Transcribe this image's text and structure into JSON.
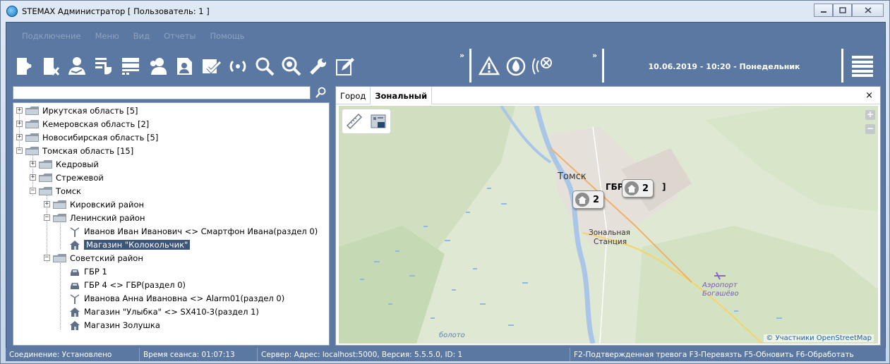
{
  "window": {
    "title": "STEMAX Администратор [ Пользователь: 1 ]",
    "controls": [
      "minimize-icon",
      "maximize-icon",
      "close-icon"
    ]
  },
  "menu": {
    "items": [
      "Подключение",
      "Меню",
      "Вид",
      "Отчеты",
      "Помощь"
    ]
  },
  "toolbar": {
    "icons": [
      "exit-door-icon",
      "exit-door-x-icon",
      "user-handshake-icon",
      "pointer-list-icon",
      "list-table-icon",
      "users-icon",
      "report-icon",
      "confirm-check-icon",
      "refresh-icon",
      "search-icon",
      "zoom-target-icon",
      "wrench-icon",
      "edit-icon"
    ],
    "overflow_label": "»",
    "alarm_icons": [
      "warning-triangle-icon",
      "fire-drop-icon",
      "no-signal-icon"
    ],
    "alarm_overflow_label": "»",
    "datetime": "10.06.2019 - 10:20 - Понедельник",
    "menu_icon": "hamburger-icon"
  },
  "search": {
    "value": "",
    "placeholder": ""
  },
  "tree": {
    "nodes": [
      {
        "label": "Иркутская область [5]",
        "expander": "+",
        "icon": "folder-icon"
      },
      {
        "label": "Кемеровская область [2]",
        "expander": "+",
        "icon": "folder-icon"
      },
      {
        "label": "Новосибирская область [5]",
        "expander": "+",
        "icon": "folder-icon"
      },
      {
        "label": "Томская область [15]",
        "expander": "−",
        "icon": "folder-icon"
      },
      {
        "label": "Кедровый",
        "expander": "+",
        "icon": "folder-icon"
      },
      {
        "label": "Стрежевой",
        "expander": "+",
        "icon": "folder-icon"
      },
      {
        "label": "Томск",
        "expander": "−",
        "icon": "folder-icon"
      },
      {
        "label": "Кировский район",
        "expander": "+",
        "icon": "folder-icon"
      },
      {
        "label": "Ленинский район",
        "expander": "−",
        "icon": "folder-icon"
      },
      {
        "label": "Иванов Иван Иванович <> Смартфон Ивана(раздел 0)",
        "expander": "",
        "icon": "person-antenna-icon"
      },
      {
        "label": "Магазин \"Колокольчик\"",
        "expander": "",
        "icon": "house-icon",
        "selected": true
      },
      {
        "label": "Советский район",
        "expander": "−",
        "icon": "folder-icon"
      },
      {
        "label": "ГБР 1",
        "expander": "",
        "icon": "car-icon"
      },
      {
        "label": "ГБР 4 <> ГБР(раздел 0)",
        "expander": "",
        "icon": "car-icon"
      },
      {
        "label": "Иванова Анна Ивановна <> Alarm01(раздел 0)",
        "expander": "",
        "icon": "person-antenna-icon"
      },
      {
        "label": "Магазин \"Улыбка\" <> SX410-3(раздел 1)",
        "expander": "",
        "icon": "house-icon"
      },
      {
        "label": "Магазин Золушка",
        "expander": "",
        "icon": "house-icon"
      }
    ]
  },
  "map": {
    "tabs": [
      {
        "label": "Город",
        "active": false
      },
      {
        "label": "Зональный",
        "active": true
      }
    ],
    "close_label": "×",
    "zoom_in_label": "+",
    "zoom_out_label": "−",
    "labels": {
      "city": "Томск",
      "gbr": "ГБР",
      "gbr_tail": "]",
      "station_1": "Зональная",
      "station_2": "Станция",
      "airport_1": "Аэропорт",
      "airport_2": "Богашёво",
      "swamp": "болото"
    },
    "clusters": [
      {
        "count": "2"
      },
      {
        "count": "2"
      }
    ],
    "attribution": "© Участники OpenStreetMap"
  },
  "status": {
    "connection": "Соединение: Установлено",
    "session": "Время сеанса: 01:07:13",
    "server": "Сервер: Адрес: localhost:5000, Версия: 5.5.5.0, ID: 1",
    "hotkeys": "F2-Подтвержденная тревога  F3-Перевязть  F5-Обновить  F6-Обработать"
  },
  "colors": {
    "frame_blue": "#5b78a3",
    "selection": "#3d5578",
    "link": "#1a5fb4"
  }
}
